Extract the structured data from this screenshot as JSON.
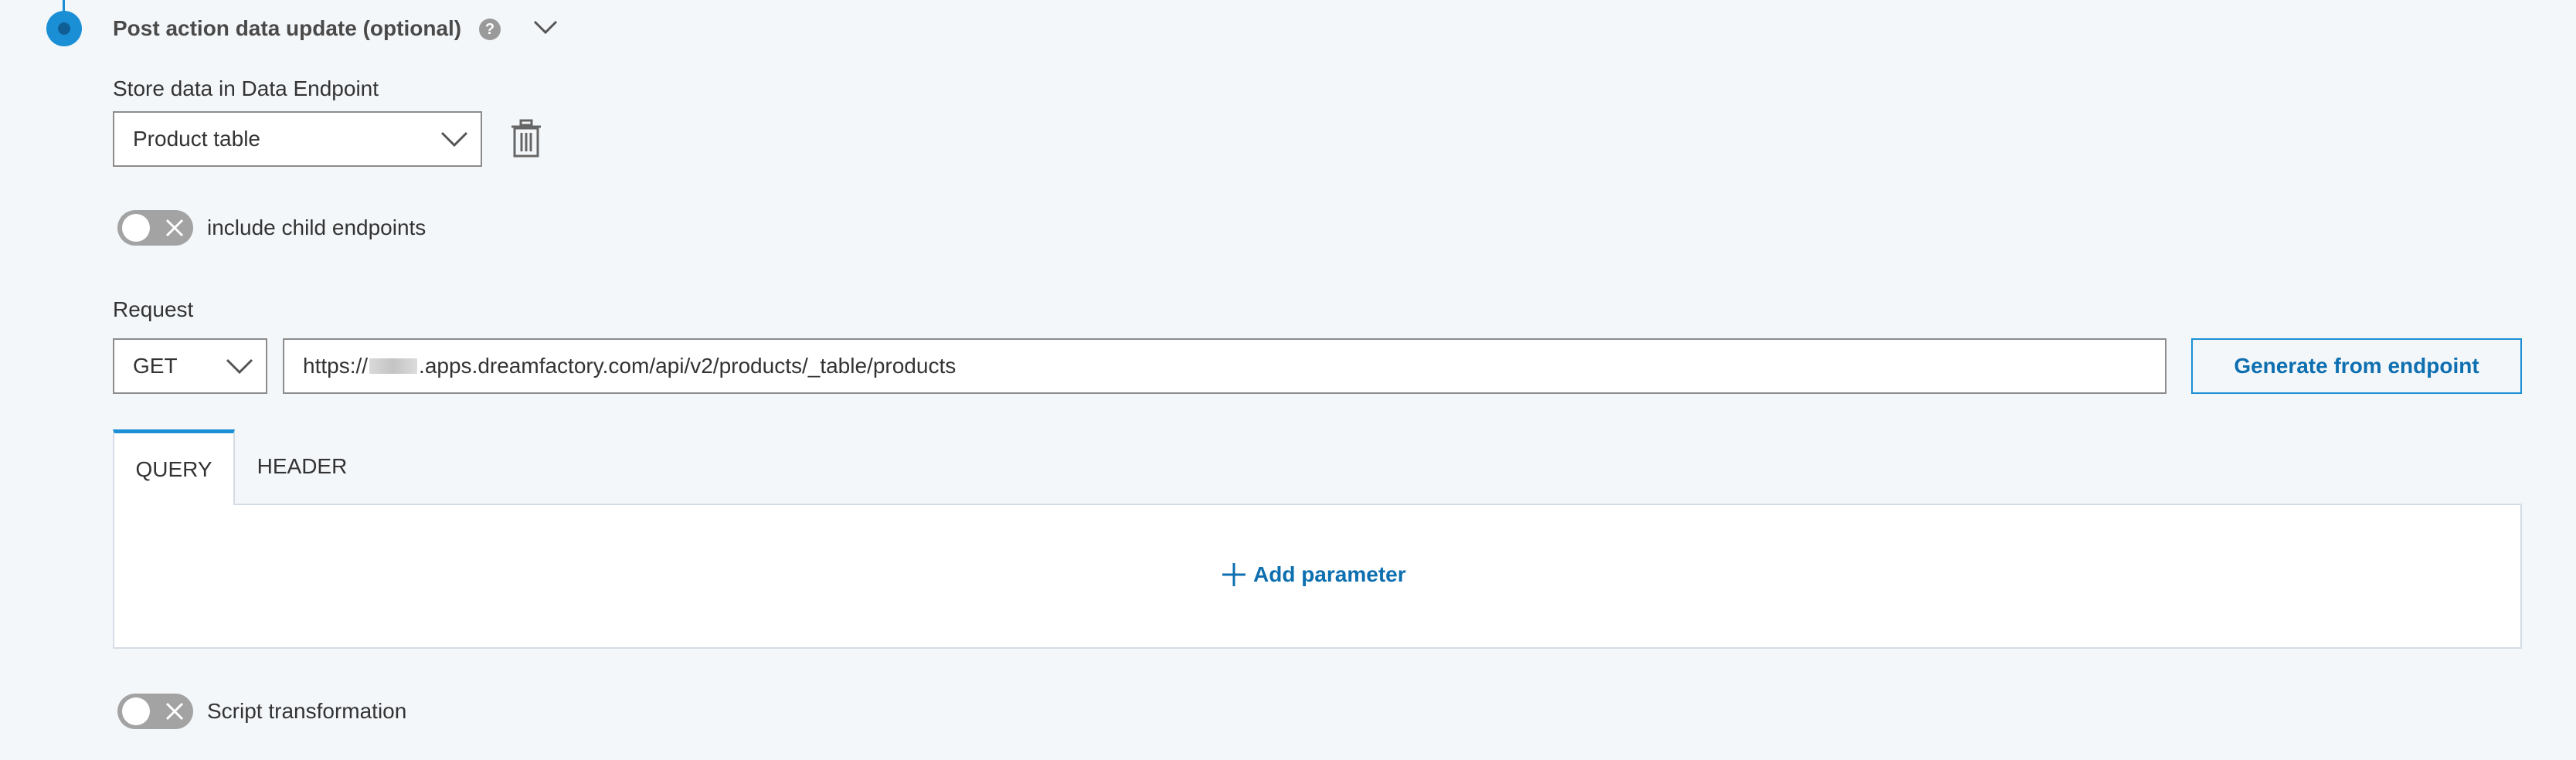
{
  "section": {
    "title": "Post action data update (optional)",
    "help_icon": "question-circle-icon",
    "collapse_icon": "chevron-down-icon"
  },
  "store": {
    "label": "Store data in Data Endpoint",
    "selected": "Product table",
    "delete_icon": "trash-icon"
  },
  "child_toggle": {
    "label": "include child endpoints",
    "state": "off"
  },
  "request": {
    "label": "Request",
    "method": "GET",
    "url_prefix": "https://",
    "url_suffix": ".apps.dreamfactory.com/api/v2/products/_table/products",
    "generate_label": "Generate from endpoint"
  },
  "tabs": {
    "items": [
      {
        "label": "QUERY",
        "active": true
      },
      {
        "label": "HEADER",
        "active": false
      }
    ],
    "add_parameter_label": "Add parameter"
  },
  "script_toggle": {
    "label": "Script transformation",
    "state": "off"
  },
  "colors": {
    "accent": "#1a8fd6",
    "link": "#0d6fb0",
    "background": "#f4f7fa",
    "toggle_off": "#a3a3a3"
  }
}
